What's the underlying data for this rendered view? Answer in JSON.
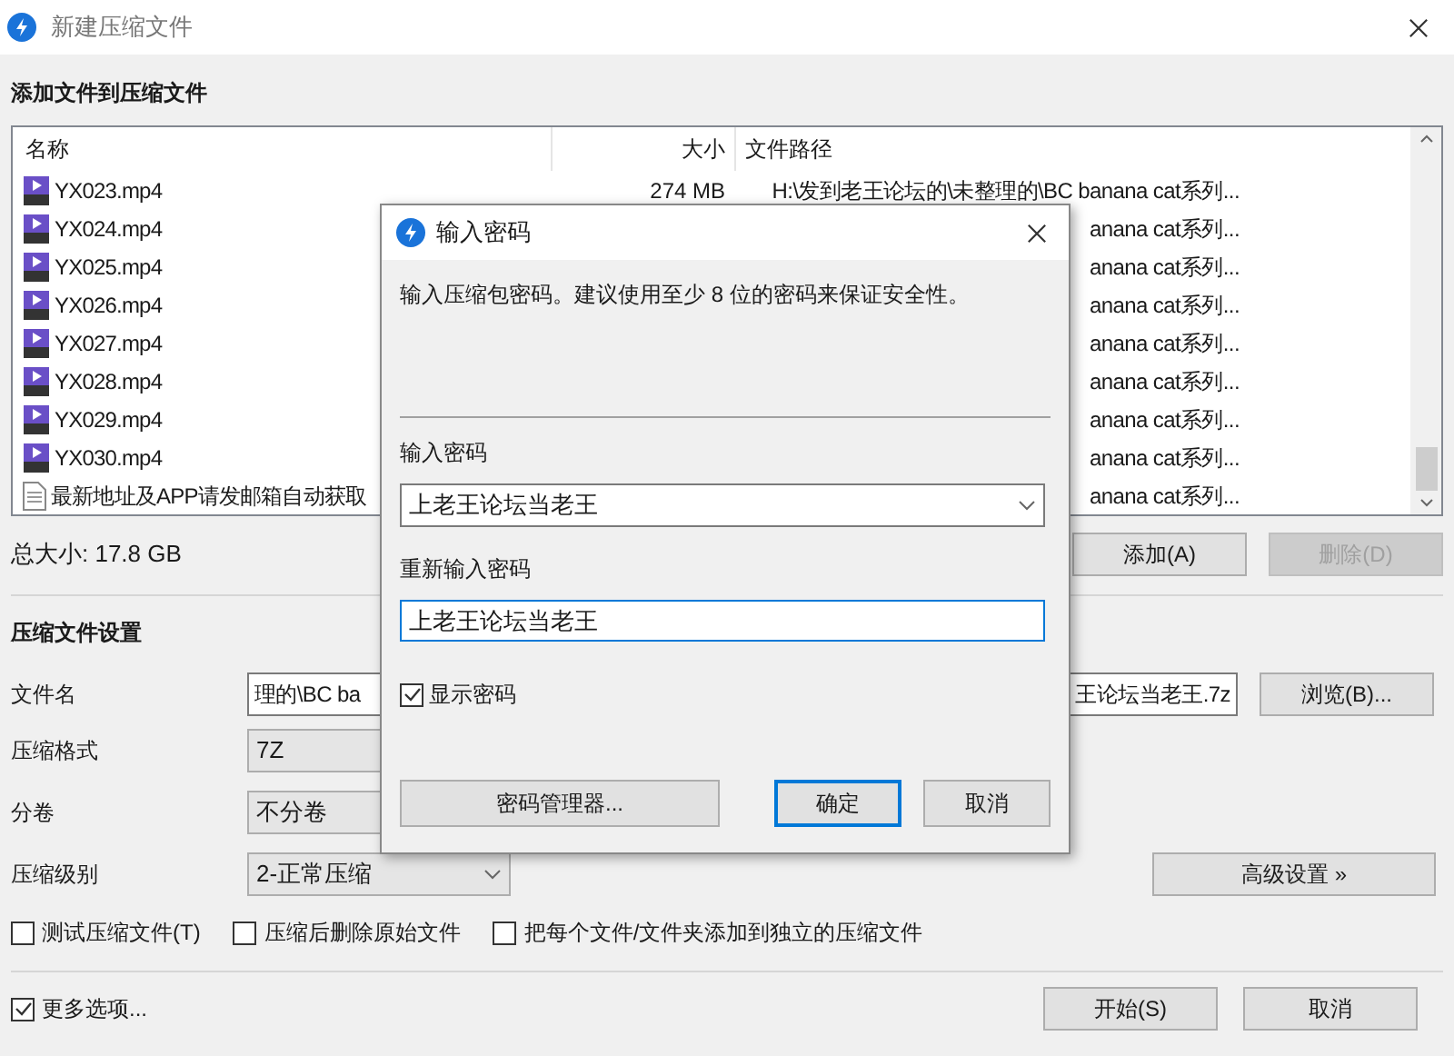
{
  "window": {
    "title": "新建压缩文件"
  },
  "add_section": {
    "heading": "添加文件到压缩文件"
  },
  "file_list": {
    "columns": [
      "名称",
      "大小",
      "文件路径"
    ],
    "rows": [
      {
        "kind": "video",
        "name": "YX023.mp4",
        "size": "274 MB",
        "path": "H:\\发到老王论坛的\\未整理的\\BC banana cat系列..."
      },
      {
        "kind": "video",
        "name": "YX024.mp4",
        "path": "anana cat系列..."
      },
      {
        "kind": "video",
        "name": "YX025.mp4",
        "path": "anana cat系列..."
      },
      {
        "kind": "video",
        "name": "YX026.mp4",
        "path": "anana cat系列..."
      },
      {
        "kind": "video",
        "name": "YX027.mp4",
        "path": "anana cat系列..."
      },
      {
        "kind": "video",
        "name": "YX028.mp4",
        "path": "anana cat系列..."
      },
      {
        "kind": "video",
        "name": "YX029.mp4",
        "path": "anana cat系列..."
      },
      {
        "kind": "video",
        "name": "YX030.mp4",
        "path": "anana cat系列..."
      },
      {
        "kind": "text",
        "name": "最新地址及APP请发邮箱自动获取",
        "path": "anana cat系列..."
      }
    ]
  },
  "total_size": "总大小: 17.8 GB",
  "list_buttons": [
    {
      "label": "添加(A)",
      "disabled": false
    },
    {
      "label": "删除(D)",
      "disabled": true
    }
  ],
  "settings": {
    "heading": "压缩文件设置",
    "filename": {
      "label": "文件名",
      "value_start": "理的\\BC ba",
      "value_end": "王论坛当老王.7z",
      "button": "浏览(B)..."
    },
    "format": {
      "label": "压缩格式",
      "value": "7Z"
    },
    "volume": {
      "label": "分卷",
      "value": "不分卷"
    },
    "level": {
      "label": "压缩级别",
      "value": "2-正常压缩"
    },
    "advanced_button": "高级设置 »"
  },
  "options": [
    {
      "label": "测试压缩文件(T)",
      "checked": false
    },
    {
      "label": "压缩后删除原始文件",
      "checked": false
    },
    {
      "label": "把每个文件/文件夹添加到独立的压缩文件",
      "checked": false
    }
  ],
  "more_options": {
    "label": "更多选项...",
    "checked": true
  },
  "footer_buttons": [
    "开始(S)",
    "取消"
  ],
  "dialog": {
    "title": "输入密码",
    "message": "输入压缩包密码。建议使用至少 8 位的密码来保证安全性。",
    "password_label": "输入密码",
    "password_value": "上老王论坛当老王",
    "confirm_label": "重新输入密码",
    "confirm_value": "上老王论坛当老王",
    "show_password": {
      "label": "显示密码",
      "checked": true
    },
    "manager_button": "密码管理器...",
    "buttons": [
      {
        "label": "确定",
        "selected": true
      },
      {
        "label": "取消",
        "selected": false
      }
    ]
  }
}
